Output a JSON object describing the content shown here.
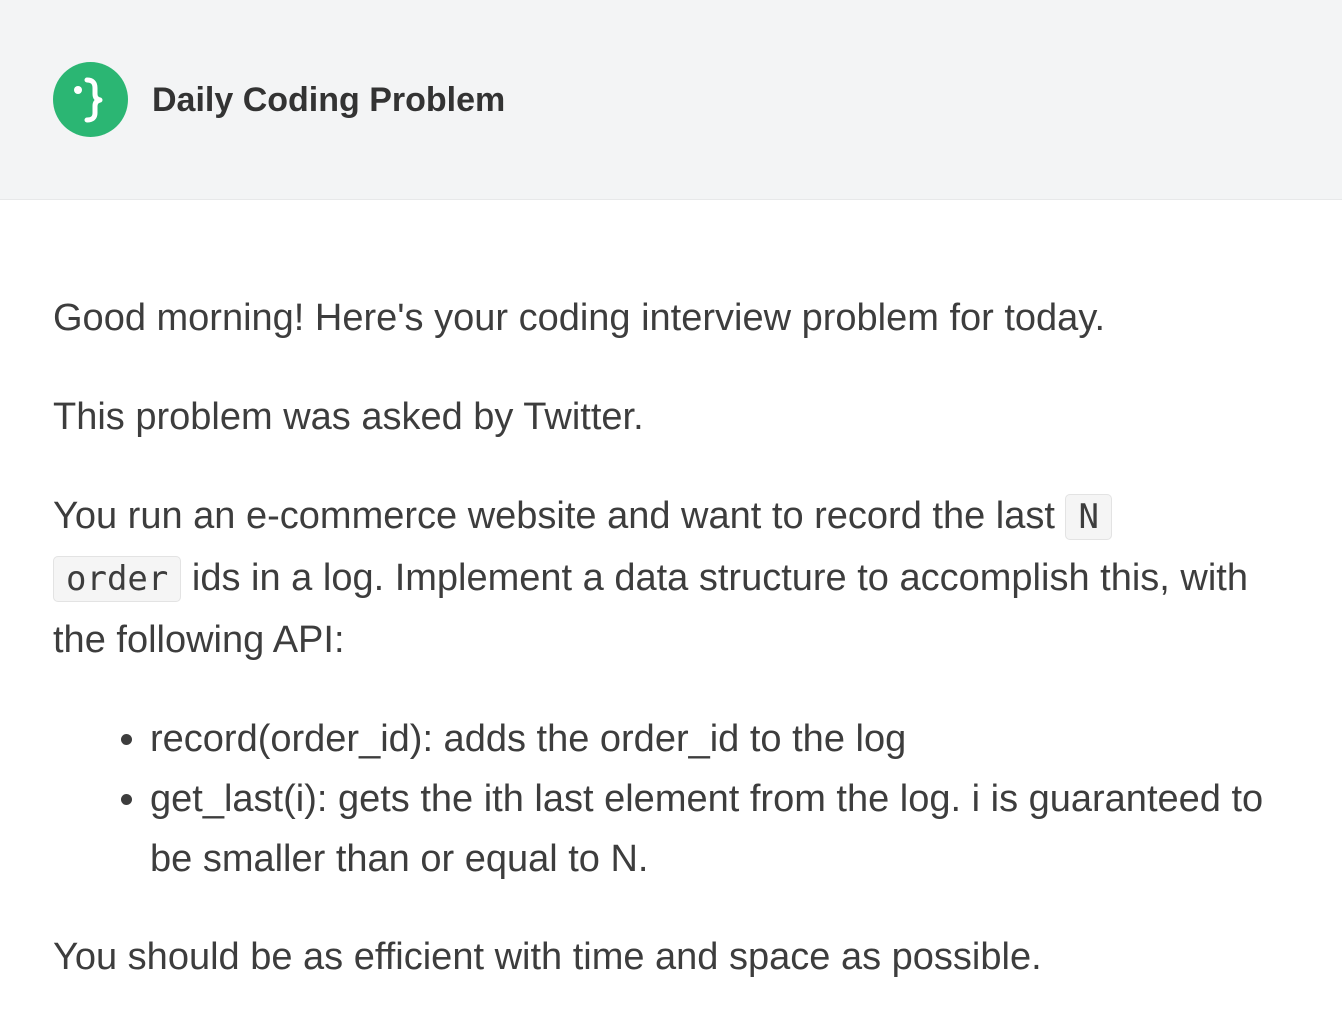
{
  "header": {
    "brand": "Daily Coding Problem",
    "logo_icon": "curly-brace-face-icon",
    "logo_color": "#2bb673"
  },
  "email": {
    "greeting": "Good morning! Here's your coding interview problem for today.",
    "asked_by": "This problem was asked by Twitter.",
    "problem_part1": "You run an e-commerce website and want to record the last ",
    "code_n": "N",
    "code_order": "order",
    "problem_part2": " ids in a log. Implement a data structure to accomplish this, with the following API:",
    "api": [
      "record(order_id): adds the order_id to the log",
      "get_last(i): gets the ith last element from the log. i is guaranteed to be smaller than or equal to N."
    ],
    "closing": "You should be as efficient with time and space as possible."
  }
}
